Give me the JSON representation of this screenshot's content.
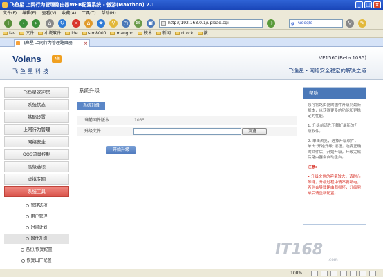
{
  "window": {
    "title": "飞鱼星 上网行为管理路由器WEB配置系统 - 傲游(Maxthon) 2.1",
    "minimize": "_",
    "maximize": "□",
    "close": "×"
  },
  "menubar": [
    "文件(F)",
    "编辑(E)",
    "查看(V)",
    "收藏(A)",
    "工具(T)",
    "帮助(H)"
  ],
  "toolbar": {
    "address": "http://192.168.0.1/upload.cgi",
    "search_placeholder": "Google"
  },
  "favorites": [
    "fav",
    "文件",
    "小说软件",
    "ide",
    "sim8000",
    "mangoo",
    "技术",
    "新闻",
    "rttock",
    "搜"
  ],
  "tabs": [
    {
      "label": "飞鱼星 上网行为管理路由器",
      "close": "×"
    }
  ],
  "header": {
    "logo_en": "Volans",
    "logo_badge": "飞鱼",
    "logo_cn": "飞鱼星科技",
    "version": "VE1560(Beta 1035)",
    "slogan": "飞鱼星・网络安全稳定的解决之道"
  },
  "sidebar": {
    "items": [
      {
        "label": "飞鱼星欢迎您",
        "active": false
      },
      {
        "label": "系统状态",
        "active": false
      },
      {
        "label": "基础设置",
        "active": false
      },
      {
        "label": "上网行为管理",
        "active": false
      },
      {
        "label": "网络安全",
        "active": false
      },
      {
        "label": "QOS流量控制",
        "active": false
      },
      {
        "label": "高级选项",
        "active": false
      },
      {
        "label": "虚拟专网",
        "active": false
      },
      {
        "label": "系统工具",
        "active": true
      }
    ],
    "subitems": [
      {
        "label": "管理选项",
        "active": false
      },
      {
        "label": "用户管理",
        "active": false
      },
      {
        "label": "时间计划",
        "active": false
      },
      {
        "label": "固件升级",
        "active": true
      },
      {
        "label": "备份/恢复配置",
        "active": false
      },
      {
        "label": "恢复出厂配置",
        "active": false
      }
    ]
  },
  "main": {
    "title": "系统升级",
    "subtab": "系统升级",
    "current_version_label": "当前固件版本",
    "current_version_value": "1035",
    "upgrade_file_label": "升级文件",
    "browse_label": "浏览...",
    "upgrade_button": "开始升级"
  },
  "help": {
    "title": "帮助",
    "intro": "您可将路由器的固件升级到最新版本，以获得更多的功能和更稳定的性能。",
    "step1": "1. 升级前请先下载好最新的升级软件。",
    "step2": "2. 单击浏览，选择升级软件，单击“开始升级”按钮，选择正确的文件后，开始升级，升级完成后路由器会自动重启。",
    "warn_title": "注意:",
    "warn_text": "• 升级文件的容量较大，请耐心等待，升级过程中请不要断电，否则会导致路由器损坏，升级完毕后请重新配置。"
  },
  "watermark": {
    "text": "IT168",
    "sub": ".com"
  },
  "status": {
    "zoom": "100%"
  }
}
